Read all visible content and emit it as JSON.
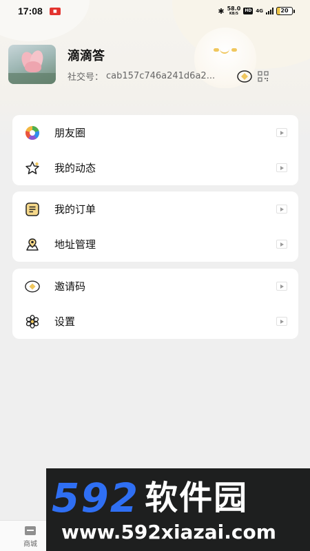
{
  "status_bar": {
    "time": "17:08",
    "net_speed_value": "58.0",
    "net_speed_unit": "KB/S",
    "hd_label": "HD",
    "network_label": "4G",
    "battery_level": "20"
  },
  "profile": {
    "username": "滴滴答",
    "social_id_label": "社交号：",
    "social_id_value": "cab157c746a241d6a2..."
  },
  "menu_groups": [
    {
      "items": [
        {
          "label": "朋友圈",
          "icon": "moments-icon"
        },
        {
          "label": "我的动态",
          "icon": "star-icon"
        }
      ]
    },
    {
      "items": [
        {
          "label": "我的订单",
          "icon": "order-icon"
        },
        {
          "label": "地址管理",
          "icon": "location-icon"
        }
      ]
    },
    {
      "items": [
        {
          "label": "邀请码",
          "icon": "invite-code-icon"
        },
        {
          "label": "设置",
          "icon": "settings-icon"
        }
      ]
    }
  ],
  "tabbar": {
    "tabs": [
      {
        "label": "商城",
        "icon": "shop-icon"
      }
    ]
  },
  "watermark": {
    "brand_digits": "592",
    "brand_name": "软件园",
    "url": "www.592xiazai.com"
  },
  "colors": {
    "accent_yellow": "#f0c75e",
    "watermark_blue": "#2f6ff3",
    "watermark_bg": "#1e1f1f",
    "page_bg": "#efefef"
  }
}
